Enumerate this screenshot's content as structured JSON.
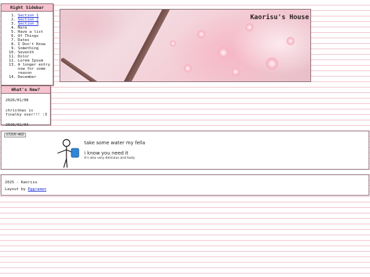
{
  "sidebar": {
    "title": "Right Sidebar",
    "items": [
      {
        "num": "1.",
        "label": "Section 1",
        "link": true
      },
      {
        "num": "2.",
        "label": "Section 2",
        "link": true
      },
      {
        "num": "3.",
        "label": "Section 3",
        "link": true
      },
      {
        "num": "4.",
        "label": "Here",
        "link": false
      },
      {
        "num": "5.",
        "label": "Have a list",
        "link": false
      },
      {
        "num": "6.",
        "label": "Of Things",
        "link": false
      },
      {
        "num": "7.",
        "label": "Dates",
        "link": false
      },
      {
        "num": "8.",
        "label": "I Don't Know",
        "link": false
      },
      {
        "num": "9.",
        "label": "Something",
        "link": false
      },
      {
        "num": "10.",
        "label": "Seventh",
        "link": false
      },
      {
        "num": "11.",
        "label": "Dolor",
        "link": false
      },
      {
        "num": "12.",
        "label": "Lorem Ipsum",
        "link": false
      },
      {
        "num": "13.",
        "label": "A longer entry now for some reason",
        "link": false
      },
      {
        "num": "14.",
        "label": "December",
        "link": false
      }
    ]
  },
  "news": {
    "title": "What's New?",
    "entries": [
      {
        "date": "2026/01/08",
        "text": "christmas is finalky over!!! :3"
      },
      {
        "date": "2026/01/04",
        "text": ""
      }
    ]
  },
  "header": {
    "site_title": "Kaorisu's House"
  },
  "stickman": {
    "label": "STICK-AGS",
    "line1": "take some water my fella",
    "line2": "i know you need it",
    "line3": "it's also very delicious and tasty"
  },
  "footer": {
    "copyright": "2025 - Kaorisu",
    "layout_prefix": "Layout by ",
    "layout_link": "Eggramen"
  },
  "colors": {
    "title_bar": "#f7c3cf",
    "border": "#8a6b74",
    "lines": "#f1c4cc",
    "link": "#1a2bd6",
    "water_bottle": "#2f86d9"
  }
}
